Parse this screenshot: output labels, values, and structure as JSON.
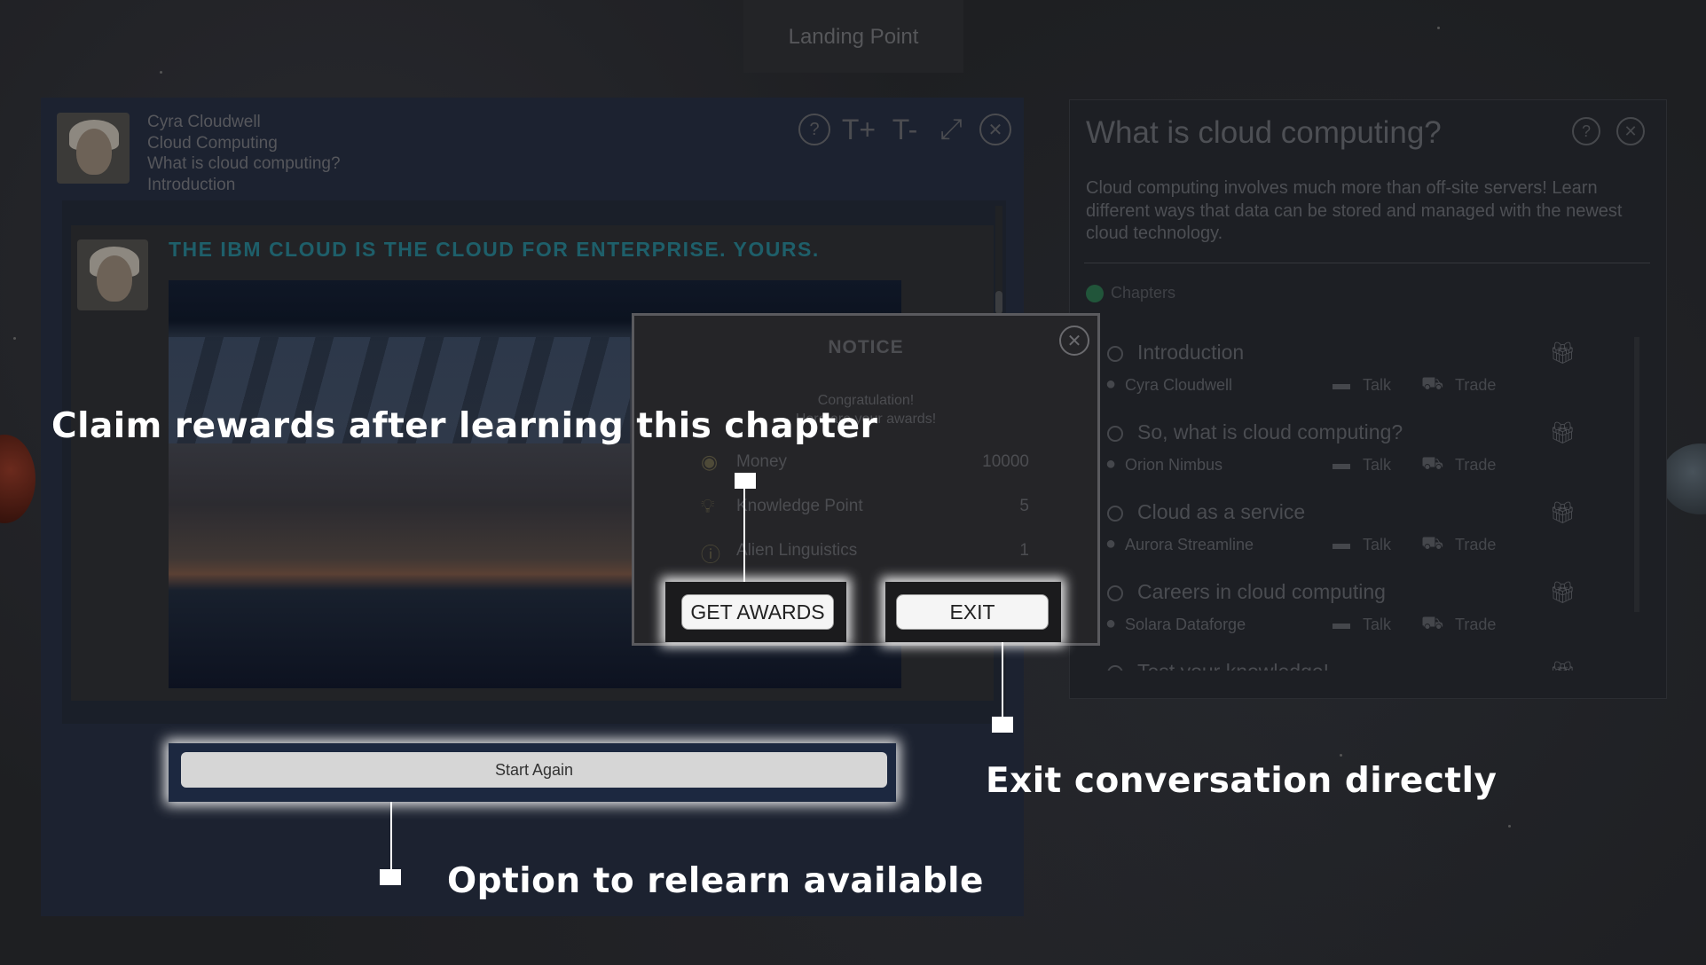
{
  "landing_tab": "Landing Point",
  "conversation": {
    "header_lines": [
      "Cyra Cloudwell",
      "Cloud Computing",
      "What is cloud computing?",
      "Introduction"
    ],
    "icons": [
      "help-icon",
      "text-increase-icon",
      "text-decrease-icon",
      "fullscreen-icon",
      "close-icon"
    ],
    "message_title": "THE IBM CLOUD IS THE CLOUD FOR ENTERPRISE. YOURS.",
    "start_again_label": "Start Again"
  },
  "chapter_panel": {
    "title": "What is cloud computing?",
    "description": "Cloud computing involves much more than off-site servers! Learn different ways that data can be stored and managed with the newest cloud technology.",
    "chapters_label": "Chapters",
    "talk_label": "Talk",
    "trade_label": "Trade",
    "items": [
      {
        "name": "Introduction",
        "mentor": "Cyra Cloudwell"
      },
      {
        "name": "So, what is cloud computing?",
        "mentor": "Orion Nimbus"
      },
      {
        "name": "Cloud as a service",
        "mentor": "Aurora Streamline"
      },
      {
        "name": "Careers in cloud computing",
        "mentor": "Solara Dataforge"
      },
      {
        "name": "Test your knowledge!",
        "mentor": ""
      }
    ]
  },
  "notice": {
    "title": "NOTICE",
    "message_line1": "Congratulation!",
    "message_line2": "Here are your awards!",
    "rewards": [
      {
        "icon": "coins-icon",
        "name": "Money",
        "value": "10000"
      },
      {
        "icon": "lightbulb-icon",
        "name": "Knowledge Point",
        "value": "5"
      },
      {
        "icon": "question-circle-icon",
        "name": "Alien Linguistics",
        "value": "1"
      }
    ],
    "get_awards_label": "GET AWARDS",
    "exit_label": "EXIT"
  },
  "annotations": {
    "claim": "Claim rewards after learning this chapter",
    "exit": "Exit conversation directly",
    "relearn": "Option to relearn available"
  }
}
